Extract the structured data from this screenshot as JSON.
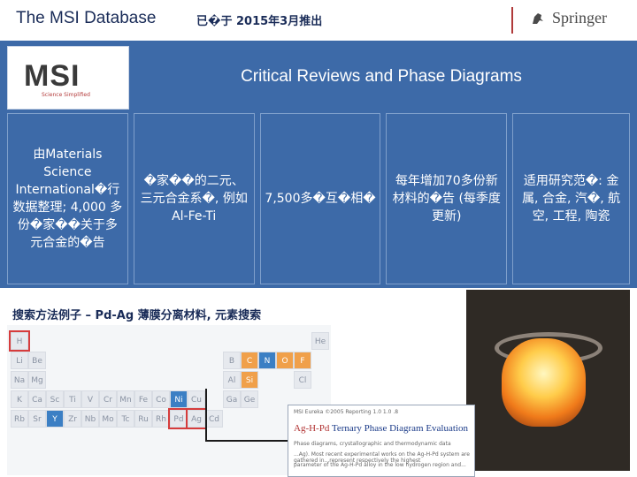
{
  "header": {
    "title": "The MSI Database",
    "subtitle": "已�于 2015年3月推出",
    "logo_text": "Springer"
  },
  "banner": {
    "logo_letters": "MSI",
    "logo_tagline": "Science Simplified",
    "title": "Critical Reviews and Phase Diagrams"
  },
  "cells": [
    "由Materials Science International�行数据整理; 4,000 多份�家��关于多元合金的�告",
    "�家��的二元、三元合金系�, 例如 Al-Fe-Ti",
    "7,500多�互�相�",
    "每年增加70多份新材料的�告 (每季度更新)",
    "适用研究范�: 金属, 合金, 汽�, 航空, 工程, 陶瓷"
  ],
  "search": {
    "label": "搜索方法例子 – Pd-Ag 薄膜分离材料, 元素搜索"
  },
  "periodic_table": {
    "elements": [
      "H",
      "He",
      "Li",
      "Be",
      "B",
      "C",
      "N",
      "O",
      "F",
      "Na",
      "Mg",
      "Al",
      "Si",
      "Cl",
      "K",
      "Ca",
      "Sc",
      "Ti",
      "V",
      "Cr",
      "Mn",
      "Fe",
      "Co",
      "Ni",
      "Cu",
      "Ga",
      "Ge",
      "Rb",
      "Sr",
      "Y",
      "Zr",
      "Nb",
      "Mo",
      "Tc",
      "Ru",
      "Rh",
      "Pd",
      "Ag",
      "Cd"
    ],
    "selected": [
      "H",
      "Pd",
      "Ag"
    ]
  },
  "popup": {
    "header": "MSI Eureka ©2005 Reporting 1.0 1.0 .8",
    "title_prefix": "Ag-H-Pd",
    "title_rest": " Ternary Phase Diagram Evaluation",
    "line1": "Phase diagrams, crystallographic and thermodynamic data",
    "line2": "...Ag). Most recent experimental works on the Ag-H-Pd system are gathered in...represent respectively the highest",
    "line3": "parameter of the Ag-H-Pd alloy in the low hydrogen region and..."
  },
  "colors": {
    "accent": "#3d6aa8",
    "title": "#1a2c58",
    "highlight": "#d63c3c"
  }
}
